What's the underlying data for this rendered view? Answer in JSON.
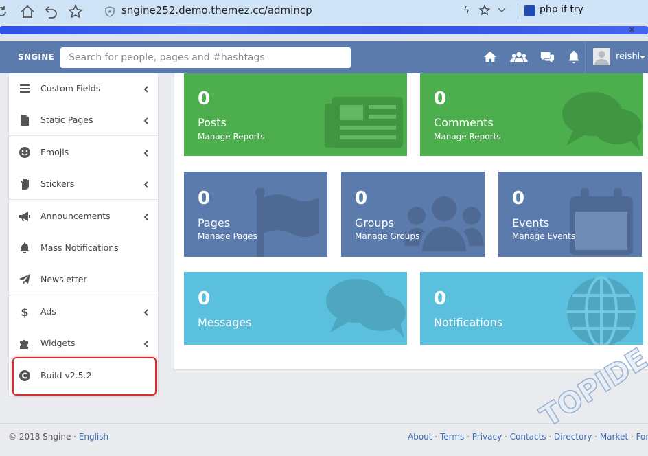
{
  "browser": {
    "url": "sngine252.demo.themez.cc/admincp",
    "profile_title": "php if try"
  },
  "header": {
    "logo": "SNGINE",
    "search_placeholder": "Search for people, pages and #hashtags",
    "nav_icons": [
      "home-icon",
      "friends-icon",
      "messages-icon",
      "notifications-icon"
    ],
    "user": "reishi"
  },
  "sidebar": {
    "items": [
      {
        "label": "Custom Fields",
        "icon": "list-icon",
        "arrow": true
      },
      {
        "label": "Static Pages",
        "icon": "file-icon",
        "arrow": true
      },
      {
        "label": "Emojis",
        "icon": "smile-icon",
        "arrow": true
      },
      {
        "label": "Stickers",
        "icon": "hand-icon",
        "arrow": true
      },
      {
        "label": "Announcements",
        "icon": "bullhorn-icon",
        "arrow": true
      },
      {
        "label": "Mass Notifications",
        "icon": "bell-icon",
        "arrow": false
      },
      {
        "label": "Newsletter",
        "icon": "paper-plane-icon",
        "arrow": false
      },
      {
        "label": "Ads",
        "icon": "dollar-icon",
        "arrow": true
      },
      {
        "label": "Widgets",
        "icon": "puzzle-icon",
        "arrow": true
      },
      {
        "label": "Build v2.5.2",
        "icon": "copyright-icon",
        "arrow": false
      }
    ]
  },
  "cards": {
    "posts": {
      "count": "0",
      "label": "Posts",
      "sub": "Manage Reports"
    },
    "comments": {
      "count": "0",
      "label": "Comments",
      "sub": "Manage Reports"
    },
    "pages": {
      "count": "0",
      "label": "Pages",
      "sub": "Manage Pages"
    },
    "groups": {
      "count": "0",
      "label": "Groups",
      "sub": "Manage Groups"
    },
    "events": {
      "count": "0",
      "label": "Events",
      "sub": "Manage Events"
    },
    "messages": {
      "count": "0",
      "label": "Messages"
    },
    "notifications": {
      "count": "0",
      "label": "Notifications"
    }
  },
  "colors": {
    "nav": "#5a7bab",
    "green": "#4cae4c",
    "blue": "#5a7bab",
    "cyan": "#5bc0de",
    "highlight": "#d62e2e"
  },
  "footer": {
    "copyright": "© 2018 Sngine · ",
    "language": "English",
    "links": [
      "About",
      "Terms",
      "Privacy",
      "Contacts",
      "Directory",
      "Market",
      "Forum"
    ]
  },
  "watermark": "TOPIDE.com"
}
